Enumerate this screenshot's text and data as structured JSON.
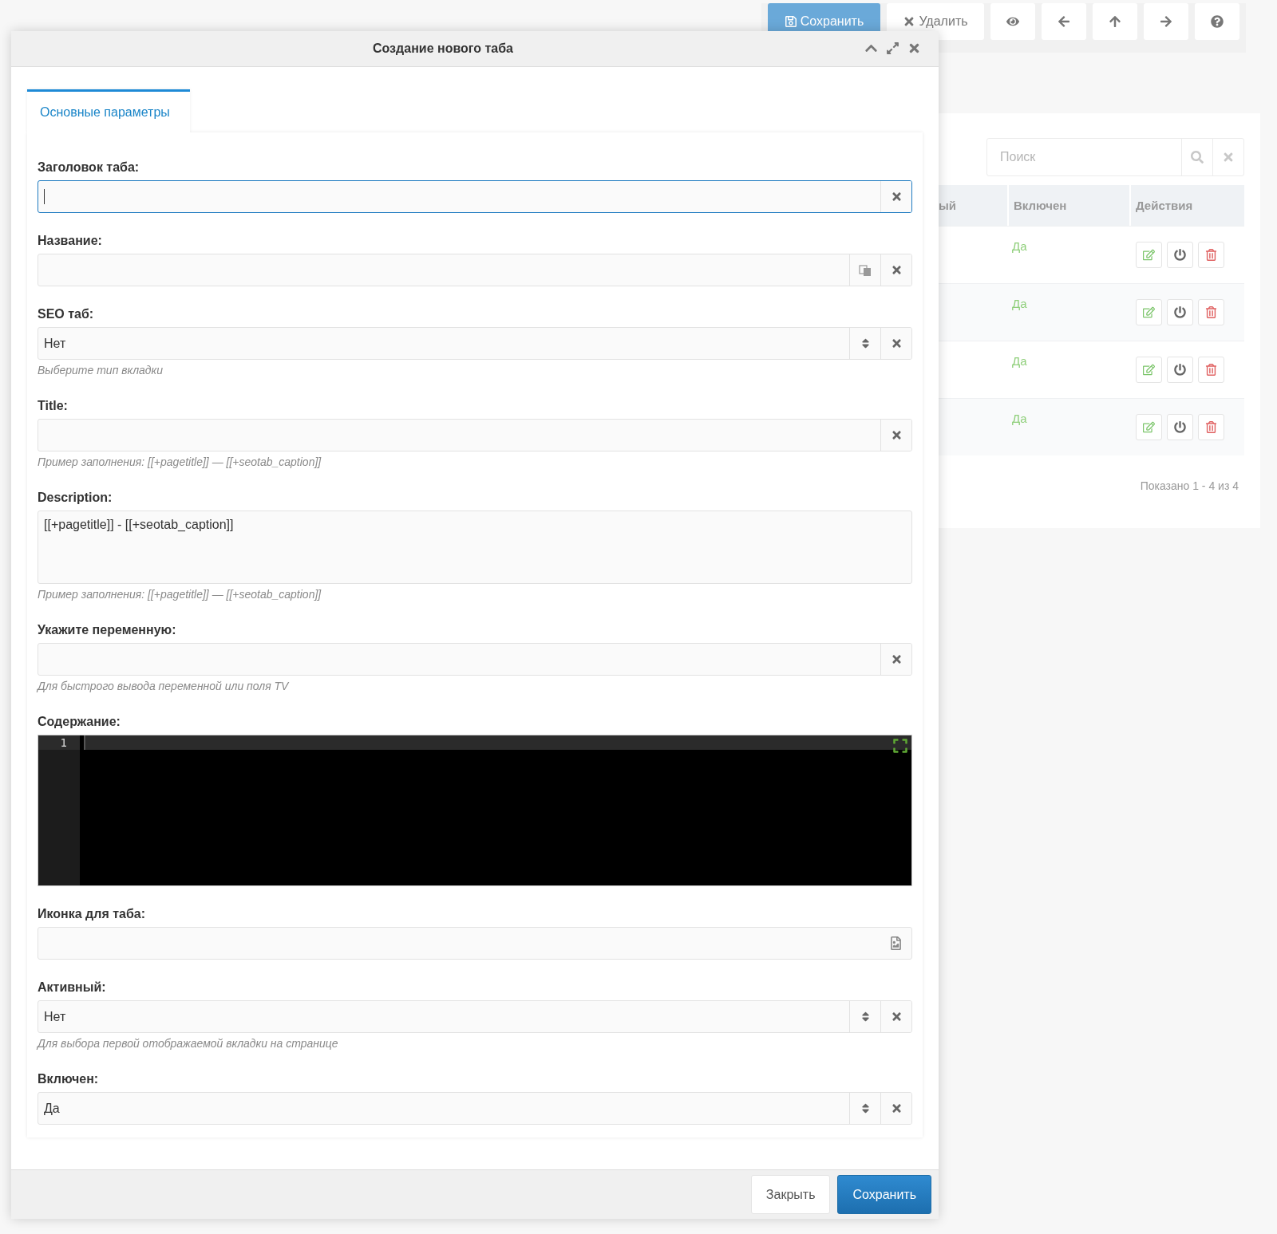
{
  "toolbar": [
    {
      "kind": "save",
      "label": "Сохранить",
      "disabled": true
    },
    {
      "kind": "delete",
      "label": "Удалить",
      "disabled": false
    },
    {
      "kind": "view",
      "disabled": false
    },
    {
      "kind": "back",
      "disabled": false
    },
    {
      "kind": "up",
      "disabled": false
    },
    {
      "kind": "forward",
      "disabled": false
    },
    {
      "kind": "help",
      "disabled": false
    }
  ],
  "list_panel": {
    "search": {
      "placeholder": "Поиск"
    },
    "table": {
      "columns": [
        "ый",
        "Включен",
        "Действия"
      ],
      "rows": [
        {
          "enabled": "Да"
        },
        {
          "enabled": "Да"
        },
        {
          "enabled": "Да"
        },
        {
          "enabled": "Да"
        }
      ]
    },
    "summary": "Показано 1 - 4 из 4"
  },
  "modal": {
    "title": "Создание нового таба",
    "tabs": [
      {
        "label": "Основные параметры",
        "selected": true
      }
    ],
    "fields": [
      {
        "kind": "text",
        "label": "Заголовок таба:",
        "focused": true
      },
      {
        "kind": "translatable",
        "label": "Название:",
        "focused": false
      },
      {
        "kind": "select",
        "label": "SEO таб:",
        "value": "Нет",
        "hint": "Выберите тип вкладки",
        "focused": false
      },
      {
        "kind": "text",
        "label": "Title:",
        "hint": "Пример заполнения: [[+pagetitle]] — [[+seotab_caption]]",
        "focused": false
      },
      {
        "kind": "textarea",
        "label": "Description:",
        "value": "[[+pagetitle]] - [[+seotab_caption]]",
        "hint": "Пример заполнения: [[+pagetitle]] — [[+seotab_caption]]",
        "focused": false
      },
      {
        "kind": "text",
        "label": "Укажите переменную:",
        "hint": "Для быстрого вывода переменной или поля TV",
        "focused": false
      },
      {
        "kind": "code",
        "label": "Содержание:",
        "lines": [
          "1"
        ],
        "focused": false
      },
      {
        "kind": "file",
        "label": "Иконка для таба:",
        "focused": false
      },
      {
        "kind": "select",
        "label": "Активный:",
        "value": "Нет",
        "hint": "Для выбора первой отображаемой вкладки на странице",
        "focused": false
      },
      {
        "kind": "select",
        "label": "Включен:",
        "value": "Да",
        "focused": false
      }
    ],
    "buttons": [
      {
        "kind": "secondary",
        "label": "Закрыть"
      },
      {
        "kind": "primary",
        "label": "Сохранить"
      }
    ]
  }
}
